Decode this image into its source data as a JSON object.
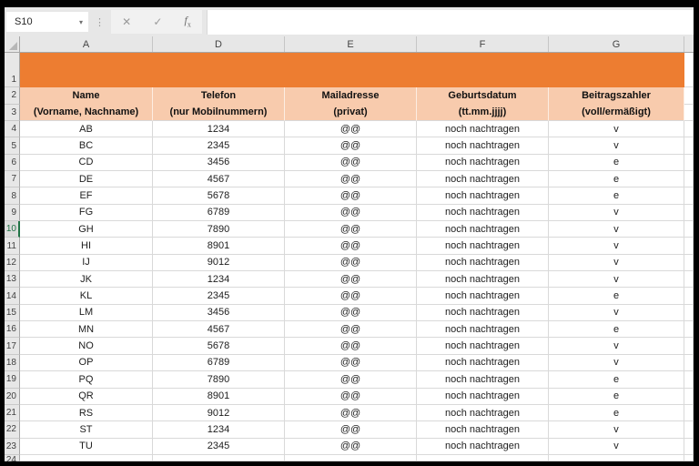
{
  "name_box": {
    "value": "S10"
  },
  "formula_bar": {
    "value": ""
  },
  "icons": {
    "dropdown": "▾",
    "separator": "⋮",
    "cancel": "✕",
    "enter": "✓",
    "fx_f": "f",
    "fx_x": "x"
  },
  "colors": {
    "band_orange": "#ED7D31",
    "header_peach": "#F8CBAD",
    "accent_green": "#217346"
  },
  "grid": {
    "visible_columns": [
      "A",
      "D",
      "E",
      "F",
      "G"
    ],
    "band_row_number": 1,
    "header_row_numbers": [
      2,
      3
    ],
    "trailing_row_number": 24,
    "selected_row": 10,
    "column_headers": [
      {
        "column": "A",
        "line1": "Name",
        "line2": "(Vorname, Nachname)"
      },
      {
        "column": "D",
        "line1": "Telefon",
        "line2": "(nur Mobilnummern)"
      },
      {
        "column": "E",
        "line1": "Mailadresse",
        "line2": "(privat)"
      },
      {
        "column": "F",
        "line1": "Geburtsdatum",
        "line2": "(tt.mm.jjjj)"
      },
      {
        "column": "G",
        "line1": "Beitragszahler",
        "line2": "(voll/ermäßigt)"
      }
    ],
    "rows": [
      {
        "row": 4,
        "cells": [
          "AB",
          "1234",
          "@@",
          "noch nachtragen",
          "v"
        ]
      },
      {
        "row": 5,
        "cells": [
          "BC",
          "2345",
          "@@",
          "noch nachtragen",
          "v"
        ]
      },
      {
        "row": 6,
        "cells": [
          "CD",
          "3456",
          "@@",
          "noch nachtragen",
          "e"
        ]
      },
      {
        "row": 7,
        "cells": [
          "DE",
          "4567",
          "@@",
          "noch nachtragen",
          "e"
        ]
      },
      {
        "row": 8,
        "cells": [
          "EF",
          "5678",
          "@@",
          "noch nachtragen",
          "e"
        ]
      },
      {
        "row": 9,
        "cells": [
          "FG",
          "6789",
          "@@",
          "noch nachtragen",
          "v"
        ]
      },
      {
        "row": 10,
        "cells": [
          "GH",
          "7890",
          "@@",
          "noch nachtragen",
          "v"
        ]
      },
      {
        "row": 11,
        "cells": [
          "HI",
          "8901",
          "@@",
          "noch nachtragen",
          "v"
        ]
      },
      {
        "row": 12,
        "cells": [
          "IJ",
          "9012",
          "@@",
          "noch nachtragen",
          "v"
        ]
      },
      {
        "row": 13,
        "cells": [
          "JK",
          "1234",
          "@@",
          "noch nachtragen",
          "v"
        ]
      },
      {
        "row": 14,
        "cells": [
          "KL",
          "2345",
          "@@",
          "noch nachtragen",
          "e"
        ]
      },
      {
        "row": 15,
        "cells": [
          "LM",
          "3456",
          "@@",
          "noch nachtragen",
          "v"
        ]
      },
      {
        "row": 16,
        "cells": [
          "MN",
          "4567",
          "@@",
          "noch nachtragen",
          "e"
        ]
      },
      {
        "row": 17,
        "cells": [
          "NO",
          "5678",
          "@@",
          "noch nachtragen",
          "v"
        ]
      },
      {
        "row": 18,
        "cells": [
          "OP",
          "6789",
          "@@",
          "noch nachtragen",
          "v"
        ]
      },
      {
        "row": 19,
        "cells": [
          "PQ",
          "7890",
          "@@",
          "noch nachtragen",
          "e"
        ]
      },
      {
        "row": 20,
        "cells": [
          "QR",
          "8901",
          "@@",
          "noch nachtragen",
          "e"
        ]
      },
      {
        "row": 21,
        "cells": [
          "RS",
          "9012",
          "@@",
          "noch nachtragen",
          "e"
        ]
      },
      {
        "row": 22,
        "cells": [
          "ST",
          "1234",
          "@@",
          "noch nachtragen",
          "v"
        ]
      },
      {
        "row": 23,
        "cells": [
          "TU",
          "2345",
          "@@",
          "noch nachtragen",
          "v"
        ]
      }
    ]
  }
}
